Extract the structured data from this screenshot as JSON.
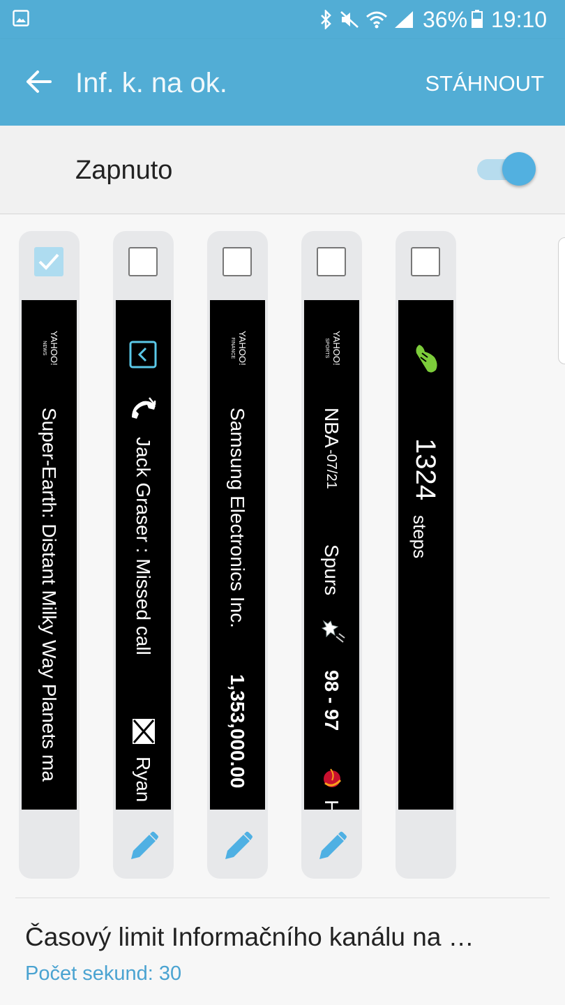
{
  "status_bar": {
    "battery_percent": "36%",
    "time": "19:10",
    "icons": [
      "gallery-icon",
      "bluetooth-icon",
      "mute-icon",
      "wifi-icon",
      "signal-icon",
      "battery-icon"
    ]
  },
  "app_bar": {
    "title": "Inf. k. na ok.",
    "action_label": "STÁHNOUT"
  },
  "master_switch": {
    "label": "Zapnuto",
    "on": true
  },
  "panels": [
    {
      "checked": true,
      "logo_line1": "YAHOO!",
      "logo_line2": "NEWS",
      "text": "Super-Earth: Distant Milky Way Planets ma",
      "editable": false
    },
    {
      "checked": false,
      "name_text": "Jack Graser : Missed call",
      "extra_text": "Ryan",
      "icons": [
        "phone-missed-icon",
        "email-icon"
      ],
      "editable": true
    },
    {
      "checked": false,
      "logo_line1": "YAHOO!",
      "logo_line2": "FINANCE",
      "company": "Samsung Electronics Inc.",
      "value": "1,353,000.00",
      "editable": true
    },
    {
      "checked": false,
      "logo_line1": "YAHOO!",
      "logo_line2": "SPORTS",
      "league": "NBA",
      "date": "-07/21",
      "team": "Spurs",
      "score": "98 - 97",
      "extra_text": "H",
      "icons": [
        "spurs-logo-icon",
        "heat-logo-icon"
      ],
      "editable": true
    },
    {
      "checked": false,
      "steps_value": "1324",
      "steps_unit": "steps",
      "icons": [
        "shoe-icon"
      ],
      "editable": false
    }
  ],
  "timeout_setting": {
    "title": "Časový limit Informačního kanálu na …",
    "subtitle": "Počet sekund: 30"
  },
  "colors": {
    "accent": "#52add5",
    "link": "#4aa3d1",
    "panel_bg": "#e7e8ea"
  }
}
